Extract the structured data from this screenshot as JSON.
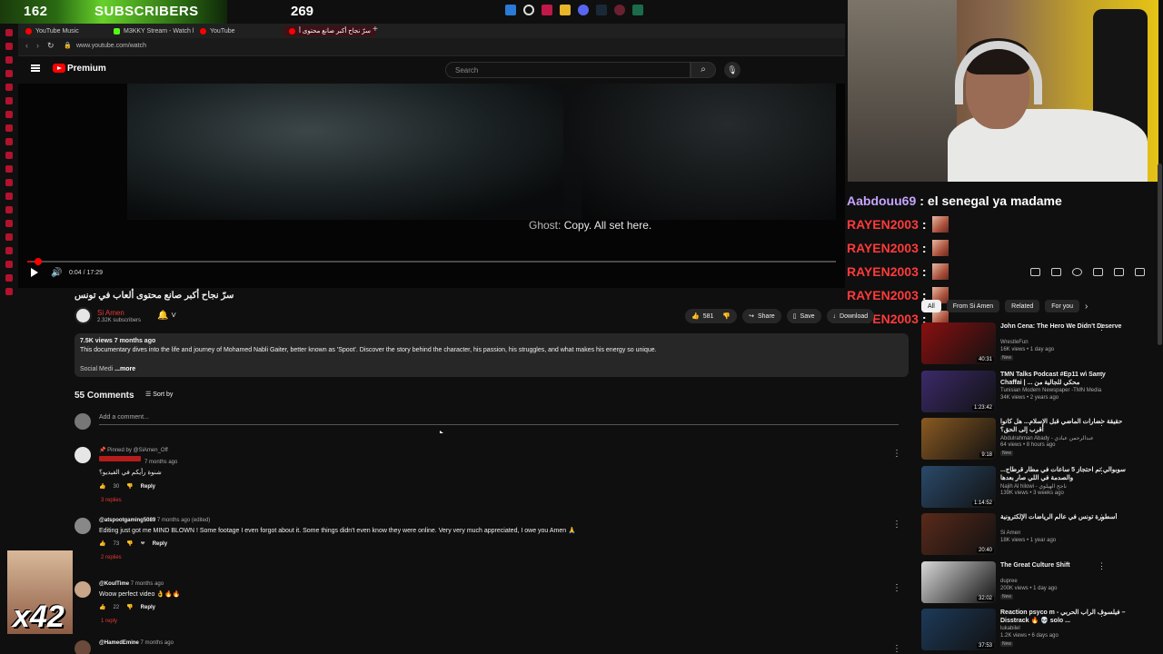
{
  "overlay": {
    "subs_count": "162",
    "subs_label": "SUBSCRIBERS",
    "goal": "269",
    "counter": "x42"
  },
  "browser": {
    "tabs": [
      {
        "label": "YouTube Music"
      },
      {
        "label": "M3KKY Stream - Watch l"
      },
      {
        "label": "YouTube"
      },
      {
        "label": "سرّ نجاح أكبر صانع محتوى أ"
      }
    ],
    "url": "www.youtube.com/watch"
  },
  "youtube": {
    "brand": "Premium",
    "search_placeholder": "Search"
  },
  "video": {
    "caption_speaker": "Ghost:",
    "caption_text": "Copy. All set here.",
    "time": "0:04 / 17:29",
    "progress_percent": 0.4,
    "title": "سرّ نجاح أكبر صانع محتوى ألعاب في تونس",
    "channel": "Si Amen",
    "subscribers": "2.32K subscribers",
    "likes": "581",
    "share": "Share",
    "save": "Save",
    "download": "Download",
    "views_date": "7.5K views  7 months ago",
    "description": "This documentary dives into the life and journey of Mohamed Nabli Gaiter, better known as 'Spoot'. Discover the story behind the character, his passion, his struggles, and what makes his energy so unique.",
    "desc_prefix": "Social Medi",
    "desc_more": "...more"
  },
  "comments": {
    "count": "55 Comments",
    "sort": "Sort by",
    "add_placeholder": "Add a comment...",
    "reply_label": "Reply",
    "list": [
      {
        "pinned": "Pinned by @SiAmen_Off",
        "time": "7 months ago",
        "text": "شنوة رأيكم في الفيديو؟",
        "likes": "30",
        "replies": "3 replies"
      },
      {
        "author": "@atspootgaming5089",
        "time": "7 months ago (edited)",
        "text": "Editing just got me MIND BLOWN ! Some footage I even forgot about it. Some things didn't even know they were online. Very very much appreciated, I owe you Amen 🙏",
        "likes": "73",
        "replies": "2 replies"
      },
      {
        "author": "@KoulTime",
        "time": "7 months ago",
        "text": "Woow perfect video 👌🔥🔥",
        "likes": "22",
        "replies": "1 reply"
      },
      {
        "author": "@HamedEmine",
        "time": "7 months ago"
      }
    ]
  },
  "chat": [
    {
      "user": "Aabdouu69",
      "msg": "el senegal ya madame"
    },
    {
      "user": "RAYEN2003"
    },
    {
      "user": "RAYEN2003"
    },
    {
      "user": "RAYEN2003"
    },
    {
      "user": "RAYEN2003"
    },
    {
      "user": "RAYEN2003"
    }
  ],
  "sidebar": {
    "chips": [
      "All",
      "From Si Amen",
      "Related",
      "For you"
    ],
    "items": [
      {
        "title": "John Cena: The Hero We Didn't Deserve",
        "channel": "WrestleFun",
        "meta": "16K views • 1 day ago",
        "badge": "New",
        "duration": "40:31",
        "thumb": "#8a1010"
      },
      {
        "title": "TMN Talks Podcast #Ep11 w\\ Samy Chaffai | ... محكي للجالية من",
        "channel": "Tunisian Modern Newspaper -TMN Media",
        "meta": "34K views • 2 years ago",
        "badge": "",
        "duration": "1:23:42",
        "thumb": "#3c2a6a"
      },
      {
        "title": "حقيقة حضارات الماضي قبل الإسلام... هل كانوا أقرب إلى الحق؟",
        "channel": "Abdulrahman Abady - عبدالرحمن عبادي",
        "meta": "64 views • 8 hours ago",
        "badge": "New",
        "duration": "9:18",
        "thumb": "#8a5a22"
      },
      {
        "title": "سوبوالي تم احتجاز 5 ساعات في مطار قرطاج... والصدمة في اللي صار بعدها",
        "channel": "Najih Al hilowi - ناجح الهيلوي",
        "meta": "139K views • 3 weeks ago",
        "badge": "",
        "duration": "1:14:52",
        "thumb": "#2a4a6a"
      },
      {
        "title": "أسطورة تونس في عالم الرياضات الإلكترونية",
        "channel": "Si Amen",
        "meta": "18K views • 1 year ago",
        "badge": "",
        "duration": "20:40",
        "thumb": "#5a2a1a"
      },
      {
        "title": "The Great Culture Shift",
        "channel": "dupree",
        "meta": "200K views • 1 day ago",
        "badge": "New",
        "duration": "32:02",
        "thumb": "#d8d8d8"
      },
      {
        "title": "Reaction psyco m - فيلسوف الراب الحربي – Disstrack 🔥 💀 solo ...",
        "channel": "lukabilel",
        "meta": "1.2K views • 6 days ago",
        "badge": "New",
        "duration": "37:53",
        "thumb": "#1d3a5a"
      }
    ]
  },
  "colors": {
    "yt_red": "#ff0000",
    "bg": "#0f0f0f",
    "chat_user": "#c6a4ff",
    "chat_red": "#ff3a3a"
  }
}
